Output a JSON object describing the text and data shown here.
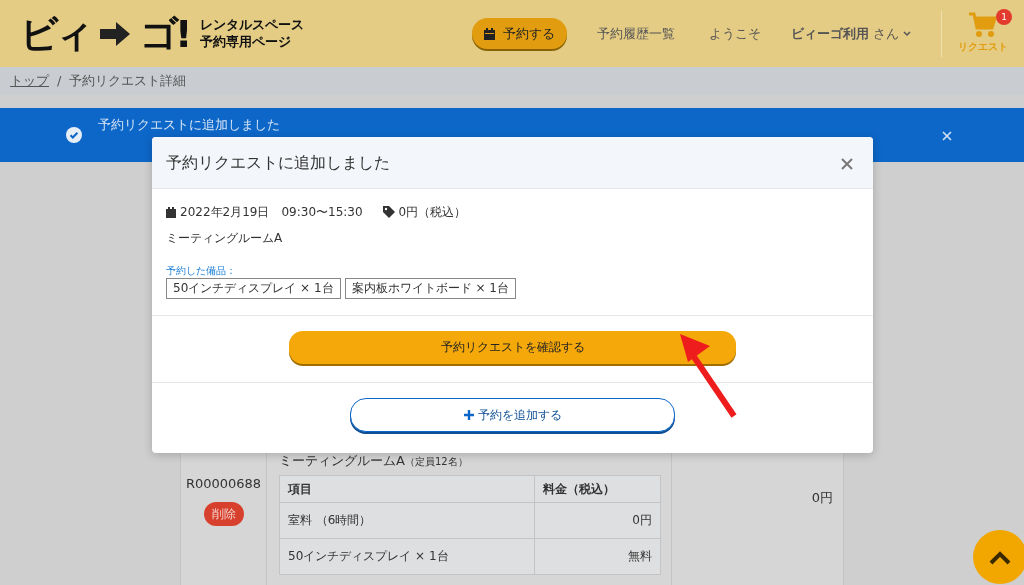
{
  "header": {
    "logo": {
      "left": "ビィ",
      "right": "ゴ!",
      "subtitle": [
        "レンタルスペース",
        "予約専用ページ"
      ]
    },
    "reserve_button": "予約する",
    "nav": [
      "予約履歴一覧",
      "ようこそ"
    ],
    "user_menu": {
      "name": "ビィーゴ利用",
      "suffix": "さん"
    },
    "cart": {
      "label": "リクエスト",
      "count": "1"
    }
  },
  "breadcrumb": {
    "separator": "/",
    "items": [
      {
        "label": "トップ",
        "link": true
      },
      {
        "label": "予約リクエスト詳細",
        "link": false
      }
    ]
  },
  "alert": {
    "message": "予約リクエストに追加しました"
  },
  "background_reservation": {
    "id": "R00000688",
    "delete_button": "削除",
    "room": "ミーティングルームA",
    "capacity": "（定員12名）",
    "columns": [
      "項目",
      "料金（税込）"
    ],
    "rows": [
      [
        "室料 （6時間）",
        "0円"
      ],
      [
        "50インチディスプレイ × 1台",
        "無料"
      ]
    ],
    "total": "0円"
  },
  "modal": {
    "title": "予約リクエストに追加しました",
    "date": "2022年2月19日　09:30〜15:30",
    "price": "0円（税込）",
    "room": "ミーティングルームA",
    "equipment_label": "予約した備品：",
    "equipment": [
      "50インチディスプレイ × 1台",
      "案内板ホワイトボード × 1台"
    ],
    "confirm_button": "予約リクエストを確認する",
    "add_button": "予約を追加する"
  }
}
